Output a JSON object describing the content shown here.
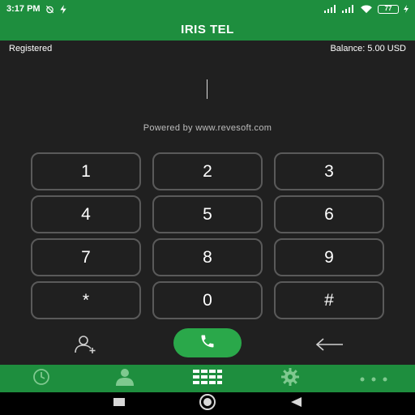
{
  "status_bar": {
    "time": "3:17 PM",
    "battery": "77"
  },
  "app_bar": {
    "title": "IRIS TEL"
  },
  "info": {
    "status": "Registered",
    "balance": "Balance: 5.00 USD"
  },
  "powered_by": "Powered by www.revesoft.com",
  "keypad": {
    "keys": [
      "1",
      "2",
      "3",
      "4",
      "5",
      "6",
      "7",
      "8",
      "9",
      "*",
      "0",
      "#"
    ]
  },
  "actions": {
    "add_contact_icon": "add-contact-icon",
    "call_icon": "phone-icon",
    "backspace_icon": "backspace-arrow-icon"
  },
  "bottom_nav": {
    "items": [
      "history-icon",
      "contacts-icon",
      "dialpad-icon",
      "settings-icon",
      "more-icon"
    ],
    "active_index": 2
  },
  "colors": {
    "brand_green": "#1e8e3e",
    "call_green": "#2aa84a",
    "background": "#202020",
    "key_border": "#5a5a5a"
  }
}
